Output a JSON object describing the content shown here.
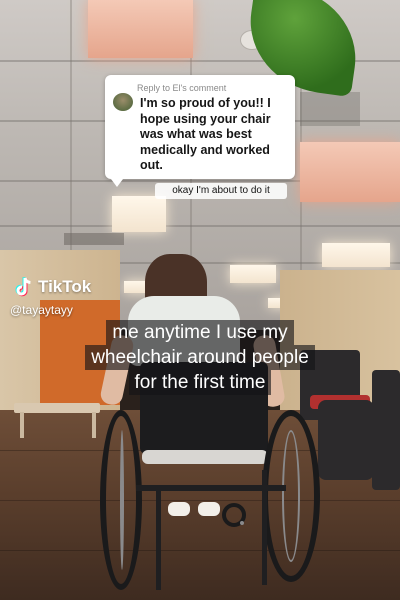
{
  "comment": {
    "reply_label": "Reply to El's comment",
    "text": "I'm so proud of you!! I hope using your chair was what was best medically and worked out."
  },
  "sticker_text": "okay I'm about to do it",
  "watermark": {
    "brand": "TikTok",
    "handle": "@tayaytayy"
  },
  "caption": {
    "line1": "me anytime I use my",
    "line2": "wheelchair around people",
    "line3": "for the first time"
  },
  "icons": [
    "tiktok-logo-icon",
    "commenter-avatar"
  ],
  "colors": {
    "tiktok_cyan": "#25F4EE",
    "tiktok_red": "#FE2C55",
    "caption_bg": "#141416"
  }
}
